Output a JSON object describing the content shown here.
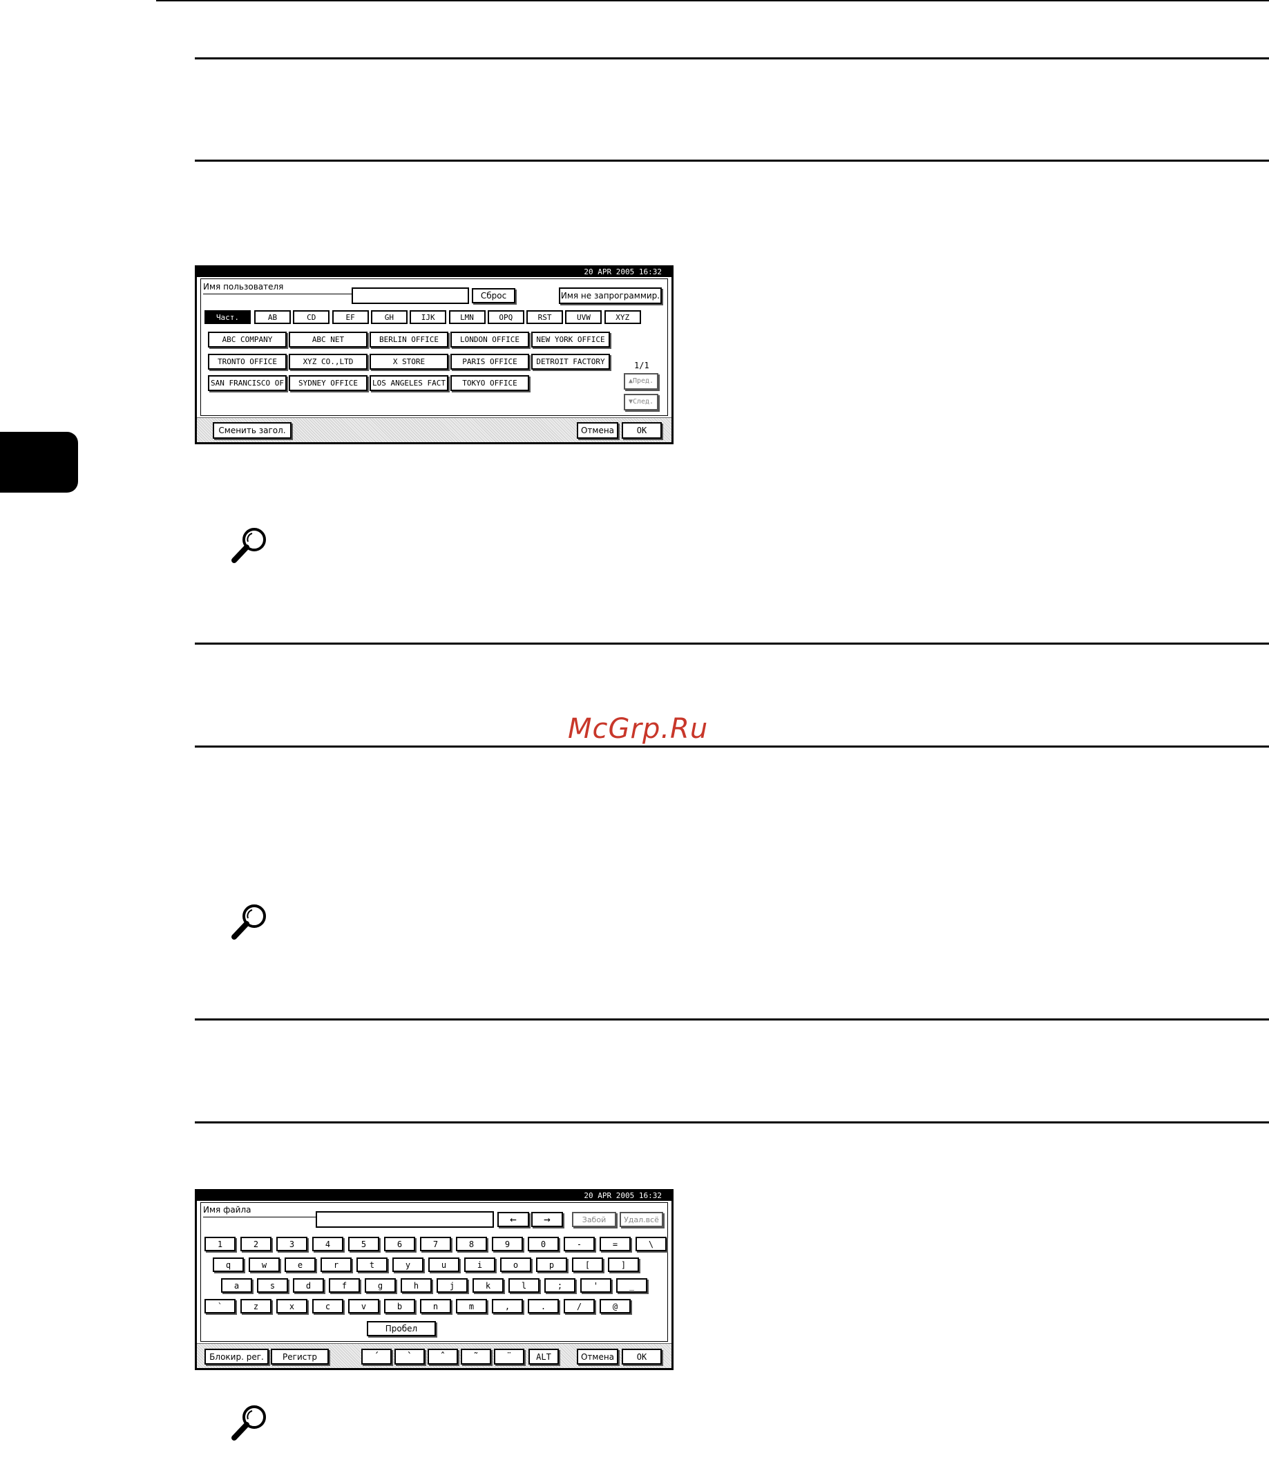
{
  "watermark": "McGrp.Ru",
  "screen1": {
    "datetime": "20 APR  2005 16:32",
    "field_label": "Имя пользователя",
    "input_value": "",
    "reset_label": "Сброс",
    "unprogrammed_label": "Имя не запрограммир.",
    "tabs": [
      "Част.",
      "AB",
      "CD",
      "EF",
      "GH",
      "IJK",
      "LMN",
      "OPQ",
      "RST",
      "UVW",
      "XYZ"
    ],
    "names": [
      [
        "ABC COMPANY",
        "ABC NET",
        "BERLIN OFFICE",
        "LONDON OFFICE",
        "NEW YORK OFFICE"
      ],
      [
        "TRONTO OFFICE",
        "XYZ CO.,LTD",
        "X STORE",
        "PARIS OFFICE",
        "DETROIT FACTORY"
      ],
      [
        "SAN FRANCISCO OF",
        "SYDNEY OFFICE",
        "LOS ANGELES FACT",
        "TOKYO OFFICE"
      ]
    ],
    "page_indicator": "1/1",
    "prev_label": "▲Пред.",
    "next_label": "▼След.",
    "change_title_label": "Сменить загол.",
    "cancel_label": "Отмена",
    "ok_label": "OK"
  },
  "screen2": {
    "datetime": "20 APR  2005 16:32",
    "field_label": "Имя файла",
    "input_value": "",
    "left_arrow": "←",
    "right_arrow": "→",
    "backspace_label": "Забой",
    "delete_label": "Удал.всё",
    "rows": [
      [
        "1",
        "2",
        "3",
        "4",
        "5",
        "6",
        "7",
        "8",
        "9",
        "0",
        "-",
        "=",
        "\\"
      ],
      [
        "q",
        "w",
        "e",
        "r",
        "t",
        "y",
        "u",
        "i",
        "o",
        "p",
        "[",
        "]"
      ],
      [
        "a",
        "s",
        "d",
        "f",
        "g",
        "h",
        "j",
        "k",
        "l",
        ";",
        "'",
        "_"
      ],
      [
        "`",
        "z",
        "x",
        "c",
        "v",
        "b",
        "n",
        "m",
        ",",
        ".",
        "/",
        "@"
      ]
    ],
    "space_label": "Пробел",
    "caps_lock_label": "Блокир. рег.",
    "shift_label": "Регистр",
    "accents": [
      "´",
      "`",
      "ˆ",
      "˜",
      "¨"
    ],
    "alt_label": "ALT",
    "cancel_label": "Отмена",
    "ok_label": "OK"
  }
}
